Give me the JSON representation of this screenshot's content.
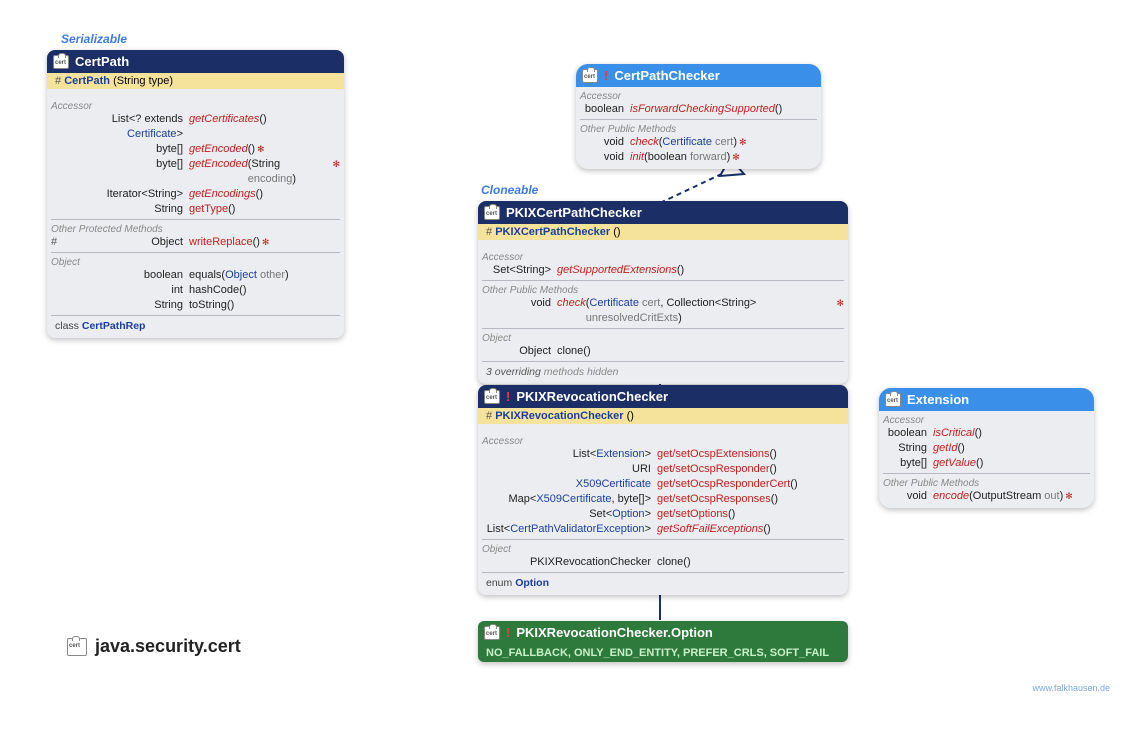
{
  "stereotypes": {
    "serializable": "Serializable",
    "cloneable": "Cloneable"
  },
  "certpath": {
    "title": "CertPath",
    "ctor_name": "CertPath",
    "ctor_params": "(String type)",
    "sec_accessor": "Accessor",
    "rows": [
      {
        "rtype_pre": "List<? extends ",
        "rtype_link": "Certificate",
        "rtype_post": ">",
        "name": "getCertificates",
        "params": "()",
        "abs": true
      },
      {
        "rtype": "byte[]",
        "name": "getEncoded",
        "params": "()",
        "throws": true,
        "abs": true
      },
      {
        "rtype": "byte[]",
        "name": "getEncoded",
        "params_html": "(String encoding)",
        "throws": true,
        "abs": true
      },
      {
        "rtype": "Iterator<String>",
        "name": "getEncodings",
        "params": "()",
        "abs": true
      },
      {
        "rtype": "String",
        "name": "getType",
        "params": "()",
        "abs": false
      }
    ],
    "sec_other_protected": "Other Protected Methods",
    "write_replace": {
      "vis": "#",
      "rtype": "Object",
      "name": "writeReplace",
      "params": "()",
      "throws": true
    },
    "sec_object": "Object",
    "obj_rows": [
      {
        "rtype": "boolean",
        "name": "equals",
        "params_html": "(Object other)"
      },
      {
        "rtype": "int",
        "name": "hashCode",
        "params": "()"
      },
      {
        "rtype": "String",
        "name": "toString",
        "params": "()"
      }
    ],
    "inner_class_label": "class",
    "inner_class": "CertPathRep"
  },
  "certpathchecker": {
    "title": "CertPathChecker",
    "sec_accessor": "Accessor",
    "acc_row": {
      "rtype": "boolean",
      "name": "isForwardCheckingSupported",
      "params": "()"
    },
    "sec_other": "Other Public Methods",
    "other_rows": [
      {
        "rtype": "void",
        "name": "check",
        "params_html": "(Certificate cert)",
        "throws": true
      },
      {
        "rtype": "void",
        "name": "init",
        "params_html": "(boolean forward)",
        "throws": true
      }
    ]
  },
  "pkixcpc": {
    "title": "PKIXCertPathChecker",
    "ctor_name": "PKIXCertPathChecker",
    "ctor_params": "()",
    "sec_accessor": "Accessor",
    "acc_row": {
      "rtype_pre": "Set<",
      "rtype_mid": "String",
      "rtype_post": ">",
      "name": "getSupportedExtensions",
      "params": "()"
    },
    "sec_other": "Other Public Methods",
    "other_row": {
      "rtype": "void",
      "name": "check",
      "params_html": "(Certificate cert, Collection<String> unresolvedCritExts)",
      "throws": true
    },
    "sec_object": "Object",
    "obj_row": {
      "rtype": "Object",
      "name": "clone",
      "params": "()"
    },
    "overriding_note": "3 overriding methods hidden"
  },
  "pkixrevoc": {
    "title": "PKIXRevocationChecker",
    "ctor_name": "PKIXRevocationChecker",
    "ctor_params": "()",
    "sec_accessor": "Accessor",
    "acc_rows": [
      {
        "rtype_pre": "List<",
        "rtype_link": "Extension",
        "rtype_post": ">",
        "name": "get/setOcspExtensions",
        "params": "()"
      },
      {
        "rtype": "URI",
        "name": "get/setOcspResponder",
        "params": "()"
      },
      {
        "rtype_link": "X509Certificate",
        "name": "get/setOcspResponderCert",
        "params": "()"
      },
      {
        "rtype_pre": "Map<",
        "rtype_link": "X509Certificate",
        "rtype_post": ", byte[]>",
        "name": "get/setOcspResponses",
        "params": "()"
      },
      {
        "rtype_pre": "Set<",
        "rtype_link": "Option",
        "rtype_post": ">",
        "name": "get/setOptions",
        "params": "()"
      },
      {
        "rtype_pre": "List<",
        "rtype_link": "CertPathValidatorException",
        "rtype_post": ">",
        "name": "getSoftFailExceptions",
        "params": "()",
        "abs": true
      }
    ],
    "sec_object": "Object",
    "obj_row": {
      "rtype": "PKIXRevocationChecker",
      "name": "clone",
      "params": "()"
    },
    "inner_enum_label": "enum",
    "inner_enum": "Option"
  },
  "extension": {
    "title": "Extension",
    "sec_accessor": "Accessor",
    "acc_rows": [
      {
        "rtype": "boolean",
        "name": "isCritical",
        "params": "()"
      },
      {
        "rtype": "String",
        "name": "getId",
        "params": "()"
      },
      {
        "rtype": "byte[]",
        "name": "getValue",
        "params": "()"
      }
    ],
    "sec_other": "Other Public Methods",
    "other_row": {
      "rtype": "void",
      "name": "encode",
      "params_html": "(OutputStream out)",
      "throws": true
    }
  },
  "option_enum": {
    "title": "PKIXRevocationChecker.Option",
    "values": "NO_FALLBACK, ONLY_END_ENTITY, PREFER_CRLS, SOFT_FAIL"
  },
  "package": "java.security.cert",
  "credit": "www.falkhausen.de"
}
